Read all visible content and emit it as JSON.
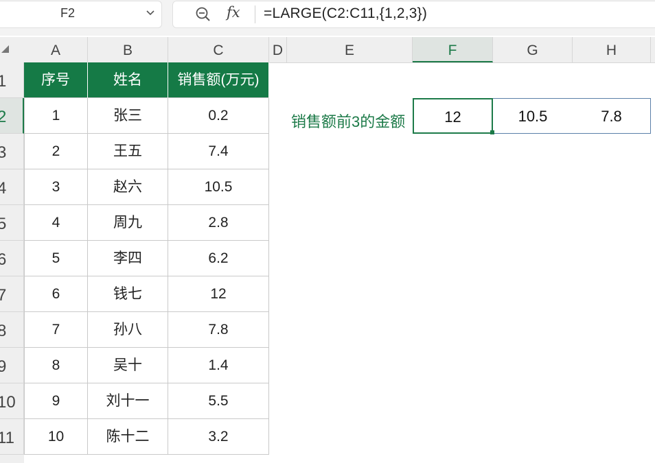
{
  "name_box": {
    "value": "F2"
  },
  "formula_bar": {
    "formula": "=LARGE(C2:C11,{1,2,3})"
  },
  "columns": [
    "A",
    "B",
    "C",
    "D",
    "E",
    "F",
    "G",
    "H"
  ],
  "active_column": "F",
  "rows": [
    "1",
    "2",
    "3",
    "4",
    "5",
    "6",
    "7",
    "8",
    "9",
    "10",
    "11"
  ],
  "active_row": "2",
  "table": {
    "headers": [
      "序号",
      "姓名",
      "销售额(万元)"
    ],
    "rows": [
      [
        "1",
        "张三",
        "0.2"
      ],
      [
        "2",
        "王五",
        "7.4"
      ],
      [
        "3",
        "赵六",
        "10.5"
      ],
      [
        "4",
        "周九",
        "2.8"
      ],
      [
        "5",
        "李四",
        "6.2"
      ],
      [
        "6",
        "钱七",
        "12"
      ],
      [
        "7",
        "孙八",
        "7.8"
      ],
      [
        "8",
        "吴十",
        "1.4"
      ],
      [
        "9",
        "刘十一",
        "5.5"
      ],
      [
        "10",
        "陈十二",
        "3.2"
      ]
    ]
  },
  "top3": {
    "label": "销售额前3的金额",
    "values": [
      "12",
      "10.5",
      "7.8"
    ]
  },
  "colors": {
    "accent": "#1c7a48",
    "header_fill": "#157a46"
  },
  "icons": [
    "chevron-down-icon",
    "zoom-out-icon",
    "fx-icon",
    "select-all-icon"
  ]
}
